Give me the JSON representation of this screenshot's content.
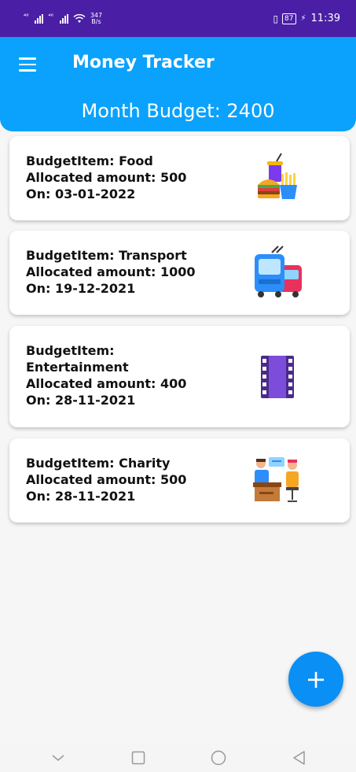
{
  "status_bar": {
    "sig1": "⁴⁶",
    "sig2": "⁴⁶",
    "net_speed_value": "347",
    "net_speed_unit": "B/s",
    "battery": "87",
    "time": "11:39"
  },
  "app_bar": {
    "title": "Money Tracker"
  },
  "budget": {
    "label": "Month Budget: 2400"
  },
  "items": [
    {
      "line1": "BudgetItem: Food",
      "line2": "Allocated amount: 500",
      "line3": "On: 03-01-2022",
      "icon": "food-icon"
    },
    {
      "line1": "BudgetItem: Transport",
      "line2": "Allocated amount: 1000",
      "line3": "On: 19-12-2021",
      "icon": "transport-icon"
    },
    {
      "line1": "BudgetItem:",
      "line1b": "Entertainment",
      "line2": "Allocated amount: 400",
      "line3": "On: 28-11-2021",
      "icon": "film-icon"
    },
    {
      "line1": "BudgetItem: Charity",
      "line2": "Allocated amount: 500",
      "line3": "On: 28-11-2021",
      "icon": "charity-icon"
    }
  ],
  "fab": {
    "label": "+"
  },
  "colors": {
    "status_bar": "#4a1fa6",
    "app_bar": "#0aa2fc",
    "fab": "#0a8ff5"
  }
}
